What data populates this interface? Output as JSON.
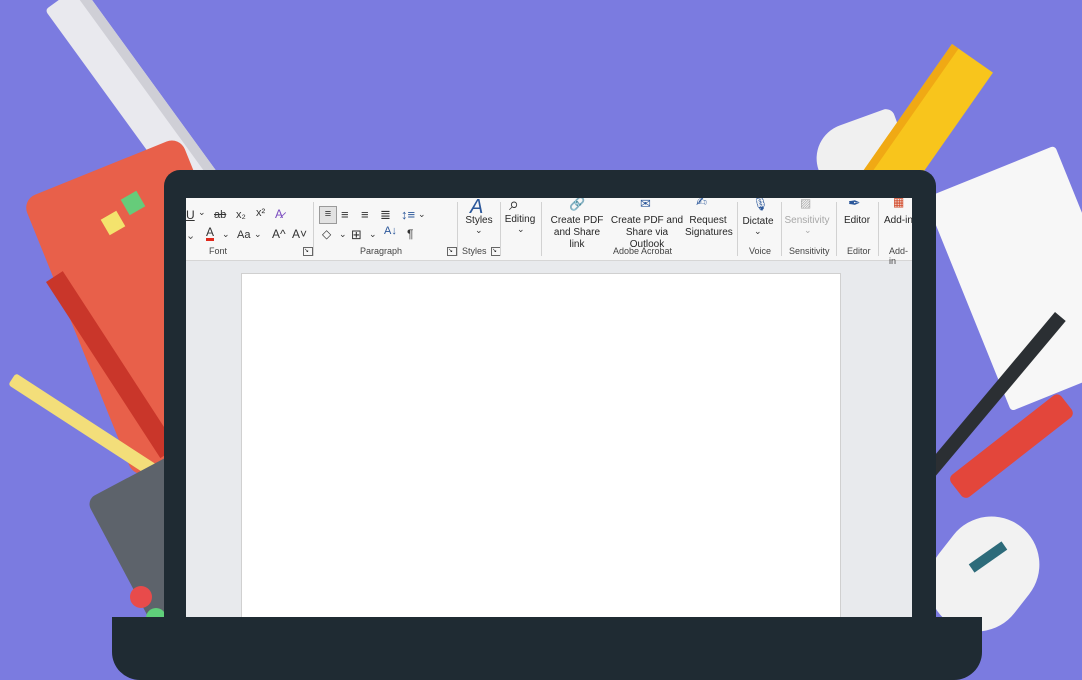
{
  "ribbon": {
    "font": {
      "label": "Font",
      "underline": "U",
      "strike": "ab",
      "subscript": "x₂",
      "superscript": "x²",
      "font_color": "A",
      "case": "Aa",
      "grow": "A^",
      "shrink": "A˅"
    },
    "paragraph": {
      "label": "Paragraph",
      "show_marks": "¶"
    },
    "styles": {
      "button": "Styles",
      "label": "Styles"
    },
    "editing": {
      "button": "Editing"
    },
    "acrobat": {
      "create_pdf_share_link_1": "Create PDF",
      "create_pdf_share_link_2": "and Share link",
      "create_pdf_outlook_1": "Create PDF and",
      "create_pdf_outlook_2": "Share via Outlook",
      "request_signatures_1": "Request",
      "request_signatures_2": "Signatures",
      "label": "Adobe Acrobat"
    },
    "voice": {
      "button": "Dictate",
      "label": "Voice"
    },
    "sensitivity": {
      "button": "Sensitivity",
      "label": "Sensitivity"
    },
    "editor": {
      "button": "Editor",
      "label": "Editor"
    },
    "addins": {
      "button": "Add-ins",
      "label": "Add-in"
    }
  },
  "colors": {
    "background": "#7b7be0",
    "laptop": "#1f2b33",
    "accent_blue": "#2b579a",
    "font_color_red": "#e0281b"
  }
}
